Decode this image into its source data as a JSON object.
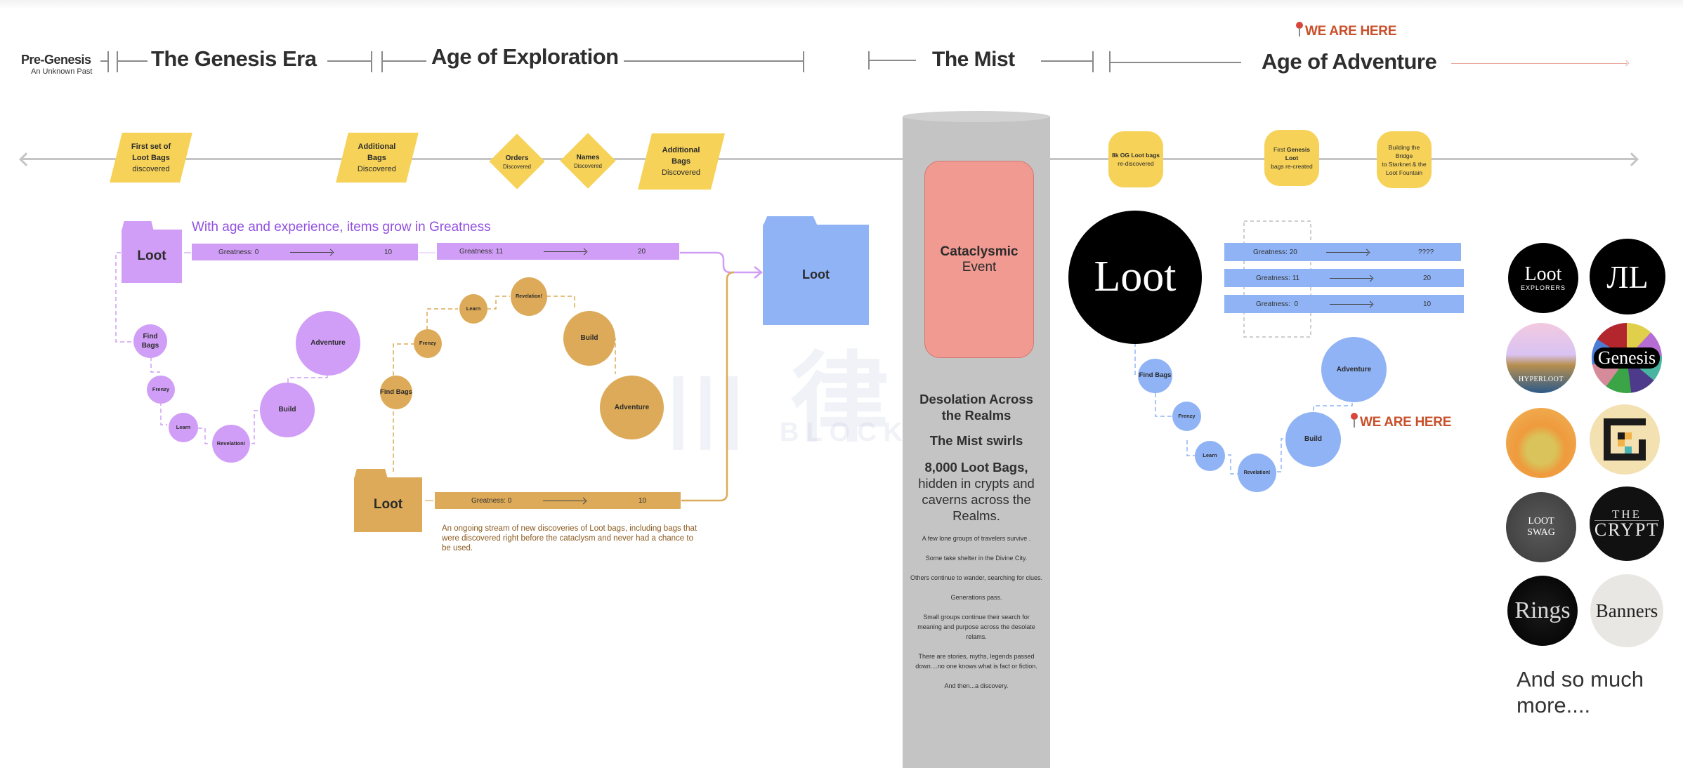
{
  "eras": {
    "pre_genesis": {
      "title": "Pre-Genesis",
      "subtitle": "An Unknown Past"
    },
    "genesis": {
      "title": "The Genesis Era"
    },
    "exploration": {
      "title": "Age of Exploration"
    },
    "mist": {
      "title": "The Mist"
    },
    "adventure": {
      "title": "Age of Adventure"
    },
    "marker": "WE ARE HERE"
  },
  "timeline": {
    "events": [
      {
        "line1": "First set of",
        "line2": "Loot Bags",
        "line3": "discovered"
      },
      {
        "line1": "Additional",
        "line2": "Bags",
        "line3": "Discovered"
      },
      {
        "title": "Orders",
        "sub": "Discovered"
      },
      {
        "title": "Names",
        "sub": "Discovered"
      },
      {
        "line1": "Additional",
        "line2": "Bags",
        "line3": "Discovered"
      },
      {
        "bold": "8k OG Loot bags",
        "rest": "re-discovered"
      },
      {
        "pre": "First ",
        "bold": "Genesis Loot",
        "rest": "bags re-created"
      },
      {
        "line1": "Building the Bridge",
        "line2": "to Starknet & the",
        "line3": "Loot Fountain"
      }
    ]
  },
  "genesis_flow": {
    "heading": "With age and experience, items grow in Greatness",
    "folder_label": "Loot",
    "bars": [
      {
        "from": "Greatness: 0",
        "to": "10"
      },
      {
        "from": "Greatness: 11",
        "to": "20"
      }
    ],
    "steps": [
      "Find Bags",
      "Frenzy",
      "Learn",
      "Revelation!",
      "Build",
      "Adventure"
    ]
  },
  "exploration_flow": {
    "folder_label": "Loot",
    "bar": {
      "from": "Greatness: 0",
      "to": "10"
    },
    "steps": [
      "Find Bags",
      "Frenzy",
      "Learn",
      "Revelation!",
      "Build",
      "Adventure"
    ],
    "note": "An ongoing stream of new discoveries of Loot bags, including bags that were discovered right before the cataclysm and never had a chance to be used."
  },
  "merged_folder": {
    "label": "Loot"
  },
  "mist": {
    "event_bold": "Cataclysmic",
    "event_rest": "Event",
    "heading1": "Desolation Across the Realms",
    "heading2": "The Mist swirls",
    "bags_bold": "8,000 Loot Bags,",
    "bags_rest": "hidden in crypts and caverns across the Realms.",
    "lines": [
      "A few lone groups of travelers survive .",
      "Some take shelter in the Divine City.",
      "Others continue to wander, searching for clues.",
      "Generations pass.",
      "Small groups continue their search for meaning and purpose across the desolate relams.",
      "There are stories, myths, legends passed down....no one knows what is fact or fiction.",
      "And then...a discovery."
    ]
  },
  "adventure_flow": {
    "logo_text": "Loot",
    "bars": [
      {
        "from": "Greatness: 20",
        "to": "????"
      },
      {
        "from": "Greatness: 11",
        "to": "20"
      },
      {
        "from": "Greatness:  0",
        "to": "10"
      }
    ],
    "steps": [
      "Find Bags",
      "Frenzy",
      "Learn",
      "Revelation!",
      "Build",
      "Adventure"
    ],
    "marker": "WE ARE HERE"
  },
  "projects": {
    "logos": [
      {
        "name": "Loot Explorers",
        "line1": "Loot",
        "line2": "EXPLORERS"
      },
      {
        "name": "Lootverse Realms",
        "line1": "ЛL"
      },
      {
        "name": "HyperLoot",
        "line1": "HYPERLOOT"
      },
      {
        "name": "Genesis",
        "line1": "Genesis"
      },
      {
        "name": "Hooded Figure",
        "line1": ""
      },
      {
        "name": "Pixel Glyph",
        "line1": ""
      },
      {
        "name": "Loot Swag",
        "line1": "LOOT",
        "line2": "SWAG"
      },
      {
        "name": "The Crypt",
        "line1": "THE",
        "line2": "CRYPT"
      },
      {
        "name": "Rings",
        "line1": "Rings"
      },
      {
        "name": "Banners",
        "line1": "Banners"
      }
    ],
    "more": "And so much more...."
  },
  "watermark": {
    "cn": "律动",
    "en": "BLOCKBEATS"
  },
  "colors": {
    "yellow": "#f6d258",
    "purple": "#d09ef6",
    "gold": "#dcaa58",
    "blue": "#8fb3f5",
    "salmon": "#f09a92",
    "mist": "#c4c4c4",
    "marker": "#c8502a"
  }
}
